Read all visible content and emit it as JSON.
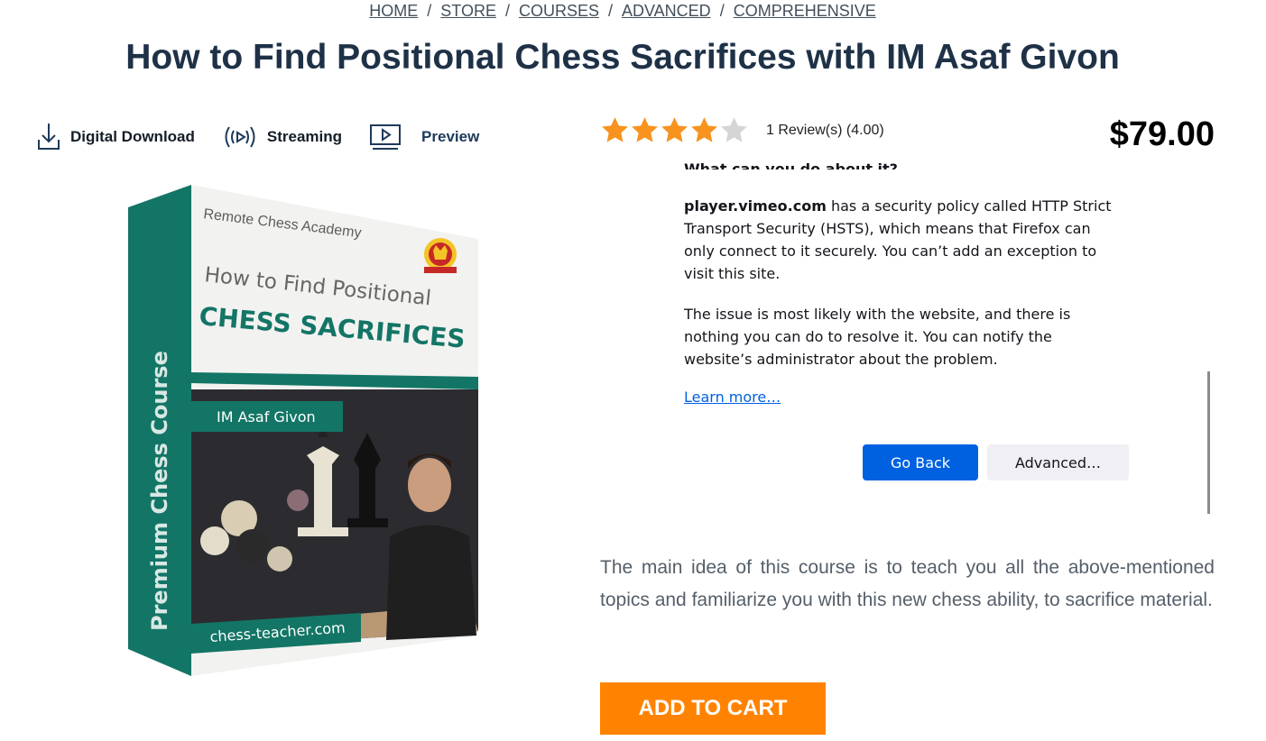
{
  "breadcrumb": {
    "items": [
      "HOME",
      "STORE",
      "COURSES",
      "ADVANCED",
      "COMPREHENSIVE"
    ],
    "separator": "/"
  },
  "title": "How to Find Positional Chess Sacrifices with IM Asaf Givon",
  "features": {
    "download": "Digital Download",
    "streaming": "Streaming",
    "preview": "Preview"
  },
  "product_box": {
    "academy": "Remote Chess Academy",
    "line1": "How to Find Positional",
    "line2": "CHESS SACRIFICES",
    "author": "IM Asaf Givon",
    "side": "Premium Chess Course",
    "url": "chess-teacher.com"
  },
  "rating": {
    "value": 4.0,
    "max": 5,
    "text": "1 Review(s) (4.00)",
    "star_color": "#f7931e",
    "empty_star_color": "#d5d5d5"
  },
  "price": "$79.00",
  "error_panel": {
    "heading": "What can you do about it?",
    "host": "player.vimeo.com",
    "para1_rest": " has a security policy called HTTP Strict Transport Security (HSTS), which means that Firefox can only connect to it securely. You can’t add an exception to visit this site.",
    "para2": "The issue is most likely with the website, and there is nothing you can do to resolve it. You can notify the website’s administrator about the problem.",
    "learn_more": "Learn more…",
    "go_back": "Go Back",
    "advanced": "Advanced…"
  },
  "description": "The main idea of this course is to teach you all the above-mentioned topics and familiarize you with this new chess ability, to sacrifice material.",
  "add_to_cart": "ADD TO CART",
  "colors": {
    "accent_orange": "#ff8300",
    "firefox_blue": "#0061e0",
    "teal": "#137566"
  }
}
